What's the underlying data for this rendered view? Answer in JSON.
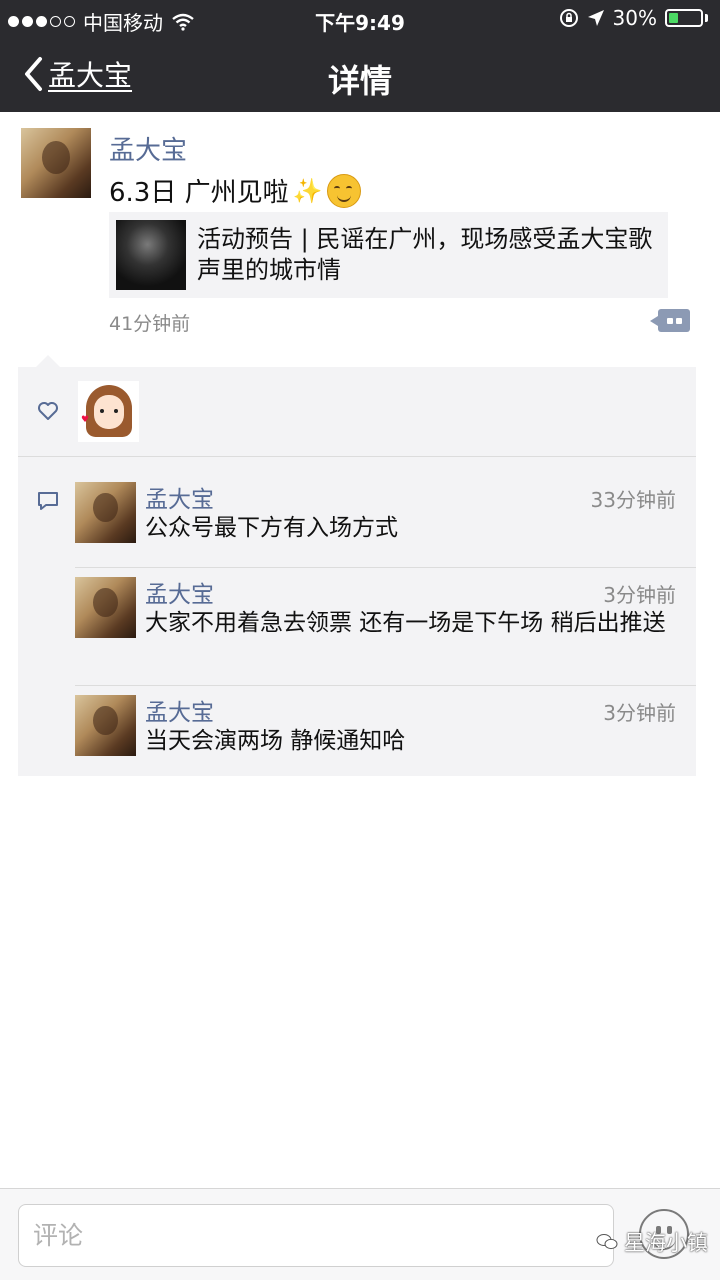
{
  "status_bar": {
    "carrier": "中国移动",
    "time": "下午9:49",
    "battery_percent": "30%",
    "battery_level": 0.3,
    "icons": [
      "signal-dots-icon",
      "wifi-icon",
      "orientation-lock-icon",
      "location-arrow-icon",
      "battery-icon"
    ]
  },
  "nav": {
    "back_label": "孟大宝",
    "title": "详情"
  },
  "post": {
    "author": "孟大宝",
    "text": "6.3日 广州见啦",
    "emojis": [
      "sparkles",
      "blushing-face"
    ],
    "link_card": {
      "title": "活动预告 | 民谣在广州，现场感受孟大宝歌声里的城市情"
    },
    "time": "41分钟前"
  },
  "likes": {
    "count": 1
  },
  "comments": [
    {
      "author": "孟大宝",
      "time": "33分钟前",
      "text": "公众号最下方有入场方式"
    },
    {
      "author": "孟大宝",
      "time": "3分钟前",
      "text": "大家不用着急去领票 还有一场是下午场 稍后出推送"
    },
    {
      "author": "孟大宝",
      "time": "3分钟前",
      "text": "当天会演两场 静候通知哈"
    }
  ],
  "bottom": {
    "comment_placeholder": "评论",
    "watermark": "星海小镇"
  },
  "colors": {
    "bar_bg": "#2b2b2f",
    "name_link": "#576b95",
    "comment_bg": "#f3f3f5",
    "battery_green": "#4cd964"
  }
}
